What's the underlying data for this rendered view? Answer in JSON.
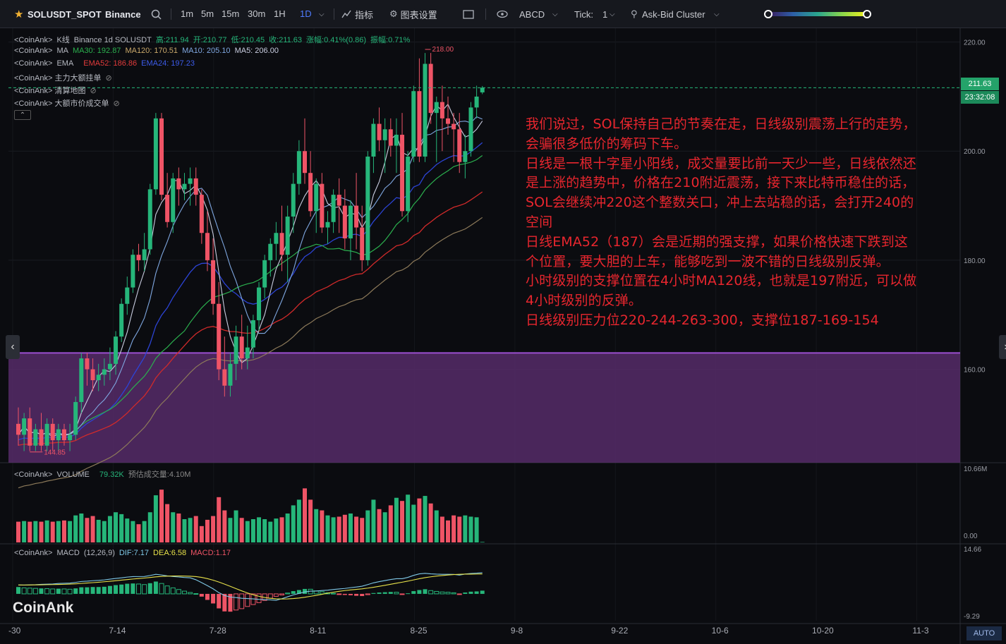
{
  "toolbar": {
    "symbol": "SOLUSDT_SPOT",
    "exchange": "Binance",
    "timeframes": [
      "1m",
      "5m",
      "15m",
      "30m",
      "1H",
      "1D"
    ],
    "active_timeframe": "1D",
    "indicators_label": "指标",
    "chart_settings_label": "图表设置",
    "abcd_label": "ABCD",
    "tick_label": "Tick:",
    "tick_value": "1",
    "cluster_label": "Ask-Bid Cluster"
  },
  "legend": {
    "kline": {
      "source": "<CoinAnk>",
      "name": "K线",
      "desc": "Binance 1d SOLUSDT",
      "high": "高:211.94",
      "open": "开:210.77",
      "low": "低:210.45",
      "close": "收:211.63",
      "change": "涨幅:0.41%(0.86)",
      "amp": "振幅:0.71%"
    },
    "ma": {
      "source": "<CoinAnk>",
      "name": "MA",
      "ma30": "MA30: 192.87",
      "ma120": "MA120: 170.51",
      "ma10": "MA10: 205.10",
      "ma5": "MA5: 206.00"
    },
    "ema": {
      "source": "<CoinAnk>",
      "name": "EMA",
      "ema52": "EMA52: 186.86",
      "ema24": "EMA24: 197.23"
    },
    "big_orders": "<CoinAnk> 主力大额挂单",
    "liq_map": "<CoinAnk> 清算地图",
    "big_trades": "<CoinAnk> 大额市价成交单",
    "volume": {
      "source": "<CoinAnk>",
      "name": "VOLUME",
      "value": "79.32K",
      "est": "预估成交量:4.10M"
    },
    "macd": {
      "source": "<CoinAnk>",
      "name": "MACD",
      "params": "(12,26,9)",
      "dif": "DIF:7.17",
      "dea": "DEA:6.58",
      "macd": "MACD:1.17"
    }
  },
  "price_axis": {
    "labels": [
      "220.00",
      "200.00",
      "180.00",
      "160.00"
    ],
    "last_price": "211.63",
    "countdown": "23:32:08",
    "high_mark": "218.00",
    "low_mark": "144.85"
  },
  "volume_axis": {
    "top": "10.66M",
    "bottom": "0.00"
  },
  "macd_axis": {
    "top": "14.66",
    "bottom": "-9.29"
  },
  "time_axis": [
    "-30",
    "7-14",
    "7-28",
    "8-11",
    "8-25",
    "9-8",
    "9-22",
    "10-6",
    "10-20",
    "11-3"
  ],
  "auto_label": "AUTO",
  "watermark": "CoinAnk",
  "note": [
    "我们说过，SOL保持自己的节奏在走，日线级别震荡上行的走势，",
    "会骗很多低价的筹码下车。",
    "日线是一根十字星小阳线，成交量要比前一天少一些，日线依然还",
    "是上涨的趋势中，价格在210附近震荡，接下来比特币稳住的话，",
    "SOL会继续冲220这个整数关口，冲上去站稳的话，会打开240的",
    "空间",
    "日线EMA52（187）会是近期的强支撑，如果价格快速下跌到这",
    "个位置，要大胆的上车，能够吃到一波不错的日线级别反弹。",
    "小时级别的支撑位置在4小时MA120线，也就是197附近，可以做",
    "4小时级别的反弹。",
    "日线级别压力位220-244-263-300，支撑位187-169-154"
  ],
  "colors": {
    "up": "#26b67a",
    "down": "#ef5466",
    "zone": "#5a2d6e",
    "zone_border": "#9b4fd0",
    "ma5": "#c9cde0",
    "ma10": "#7fa7e0",
    "ma30": "#2bb04e",
    "ma120": "#8d7a5a",
    "ema24": "#2c44d6",
    "ema52": "#d12a2a"
  },
  "chart_data": {
    "type": "candlestick",
    "x_start": "6-30",
    "ylim": [
      143,
      221.5
    ],
    "candles": [
      [
        150,
        153,
        146,
        148
      ],
      [
        148,
        152,
        145,
        151
      ],
      [
        151,
        153,
        145,
        146
      ],
      [
        146,
        150,
        145,
        149
      ],
      [
        149,
        152,
        145,
        146
      ],
      [
        146,
        151,
        145,
        150
      ],
      [
        150,
        151,
        145,
        147
      ],
      [
        147,
        150,
        145,
        149
      ],
      [
        149,
        150,
        146,
        147
      ],
      [
        147,
        150,
        145,
        148
      ],
      [
        148,
        155,
        147,
        154
      ],
      [
        154,
        163,
        152,
        162
      ],
      [
        162,
        163,
        157,
        160
      ],
      [
        160,
        162,
        156,
        158
      ],
      [
        158,
        161,
        156,
        159
      ],
      [
        159,
        162,
        157,
        160
      ],
      [
        160,
        164,
        158,
        161
      ],
      [
        161,
        167,
        159,
        166
      ],
      [
        166,
        173,
        165,
        172
      ],
      [
        172,
        177,
        170,
        175
      ],
      [
        175,
        182,
        174,
        181
      ],
      [
        181,
        183,
        178,
        180
      ],
      [
        180,
        185,
        178,
        182
      ],
      [
        182,
        194,
        181,
        193
      ],
      [
        193,
        207,
        192,
        206
      ],
      [
        206,
        207,
        191,
        192
      ],
      [
        192,
        196,
        186,
        187
      ],
      [
        187,
        196,
        185,
        195
      ],
      [
        195,
        197,
        190,
        193
      ],
      [
        193,
        196,
        191,
        194
      ],
      [
        194,
        197,
        190,
        195
      ],
      [
        195,
        197,
        190,
        192
      ],
      [
        192,
        193,
        183,
        185
      ],
      [
        185,
        189,
        178,
        180
      ],
      [
        180,
        184,
        170,
        172
      ],
      [
        172,
        176,
        158,
        160
      ],
      [
        160,
        166,
        155,
        157
      ],
      [
        157,
        163,
        155,
        161
      ],
      [
        161,
        168,
        158,
        166
      ],
      [
        166,
        170,
        160,
        162
      ],
      [
        162,
        168,
        160,
        164
      ],
      [
        164,
        170,
        162,
        169
      ],
      [
        169,
        176,
        167,
        175
      ],
      [
        175,
        181,
        173,
        180
      ],
      [
        180,
        184,
        177,
        183
      ],
      [
        183,
        187,
        180,
        185
      ],
      [
        185,
        190,
        178,
        181
      ],
      [
        181,
        190,
        176,
        188
      ],
      [
        188,
        196,
        185,
        194
      ],
      [
        194,
        202,
        192,
        200
      ],
      [
        200,
        206,
        194,
        196
      ],
      [
        196,
        200,
        188,
        189
      ],
      [
        189,
        195,
        185,
        194
      ],
      [
        194,
        196,
        185,
        186
      ],
      [
        186,
        189,
        183,
        187
      ],
      [
        187,
        193,
        185,
        192
      ],
      [
        192,
        195,
        185,
        190
      ],
      [
        190,
        193,
        182,
        184
      ],
      [
        184,
        191,
        180,
        190
      ],
      [
        190,
        196,
        182,
        186
      ],
      [
        186,
        190,
        178,
        180
      ],
      [
        180,
        200,
        179,
        199
      ],
      [
        199,
        206,
        196,
        205
      ],
      [
        205,
        208,
        200,
        202
      ],
      [
        202,
        206,
        196,
        204
      ],
      [
        204,
        206,
        199,
        201
      ],
      [
        201,
        206,
        196,
        203
      ],
      [
        203,
        207,
        188,
        189
      ],
      [
        189,
        200,
        187,
        199
      ],
      [
        199,
        212,
        198,
        211
      ],
      [
        211,
        217,
        198,
        199
      ],
      [
        199,
        218,
        198,
        216
      ],
      [
        216,
        218,
        205,
        207
      ],
      [
        207,
        210,
        198,
        209
      ],
      [
        209,
        212,
        200,
        206
      ],
      [
        206,
        210,
        203,
        205
      ],
      [
        205,
        207,
        198,
        204
      ],
      [
        204,
        207,
        196,
        198
      ],
      [
        198,
        203,
        195,
        200
      ],
      [
        200,
        209,
        199,
        208
      ],
      [
        208,
        212,
        206,
        210
      ],
      [
        210.77,
        211.94,
        210.45,
        211.63
      ]
    ],
    "volume_m": [
      3.3,
      3.4,
      3.3,
      3.4,
      3.3,
      3.5,
      3.3,
      3.4,
      3.5,
      3.4,
      4.3,
      4.6,
      3.9,
      4.2,
      3.6,
      3.4,
      4.2,
      4.8,
      4.5,
      3.8,
      3.4,
      2.9,
      3.4,
      4.8,
      7.5,
      8.4,
      6.1,
      4.8,
      4.6,
      3.7,
      3.9,
      4.2,
      2.6,
      3.6,
      4.2,
      7.2,
      5.1,
      3.9,
      5.1,
      3.9,
      3.4,
      3.7,
      4.0,
      3.7,
      3.3,
      3.8,
      4.0,
      4.6,
      5.9,
      6.8,
      8.6,
      6.8,
      5.3,
      5.1,
      4.3,
      4.0,
      4.1,
      4.4,
      4.6,
      4.1,
      3.9,
      5.1,
      6.8,
      5.3,
      4.8,
      5.9,
      7.1,
      6.6,
      7.6,
      6.0,
      7.0,
      7.4,
      6.2,
      5.1,
      4.1,
      3.5,
      4.3,
      4.1,
      4.3,
      4.1,
      4.0,
      0.08
    ],
    "macd_hist": [
      2.5,
      2.2,
      2.1,
      2.0,
      2.0,
      1.9,
      1.8,
      1.9,
      1.8,
      1.7,
      2.0,
      2.4,
      2.4,
      2.5,
      2.5,
      2.6,
      2.9,
      3.2,
      3.4,
      3.7,
      3.8,
      3.6,
      3.4,
      3.9,
      4.5,
      3.8,
      2.9,
      2.2,
      1.6,
      1.0,
      0.5,
      0.1,
      -1.0,
      -2.2,
      -3.5,
      -5.3,
      -6.4,
      -6.5,
      -5.9,
      -5.4,
      -4.6,
      -3.9,
      -3.2,
      -2.4,
      -1.6,
      -0.9,
      -0.4,
      0.3,
      1.0,
      1.4,
      1.8,
      1.7,
      1.1,
      0.8,
      0.4,
      0.2,
      -0.1,
      -0.4,
      -0.5,
      -0.7,
      -0.8,
      -0.3,
      0.3,
      0.5,
      0.6,
      0.7,
      0.6,
      -0.1,
      0.2,
      1.0,
      1.4,
      1.7,
      1.2,
      0.9,
      0.7,
      0.6,
      0.4,
      -0.2,
      0.5,
      0.8,
      0.9,
      1.17
    ],
    "macd_ylim": [
      -9.29,
      14.66
    ],
    "zone": [
      147,
      163
    ],
    "x_labels": [
      "-30",
      "7-14",
      "7-28",
      "8-11",
      "8-25",
      "9-8",
      "9-22",
      "10-6",
      "10-20",
      "11-3"
    ]
  }
}
